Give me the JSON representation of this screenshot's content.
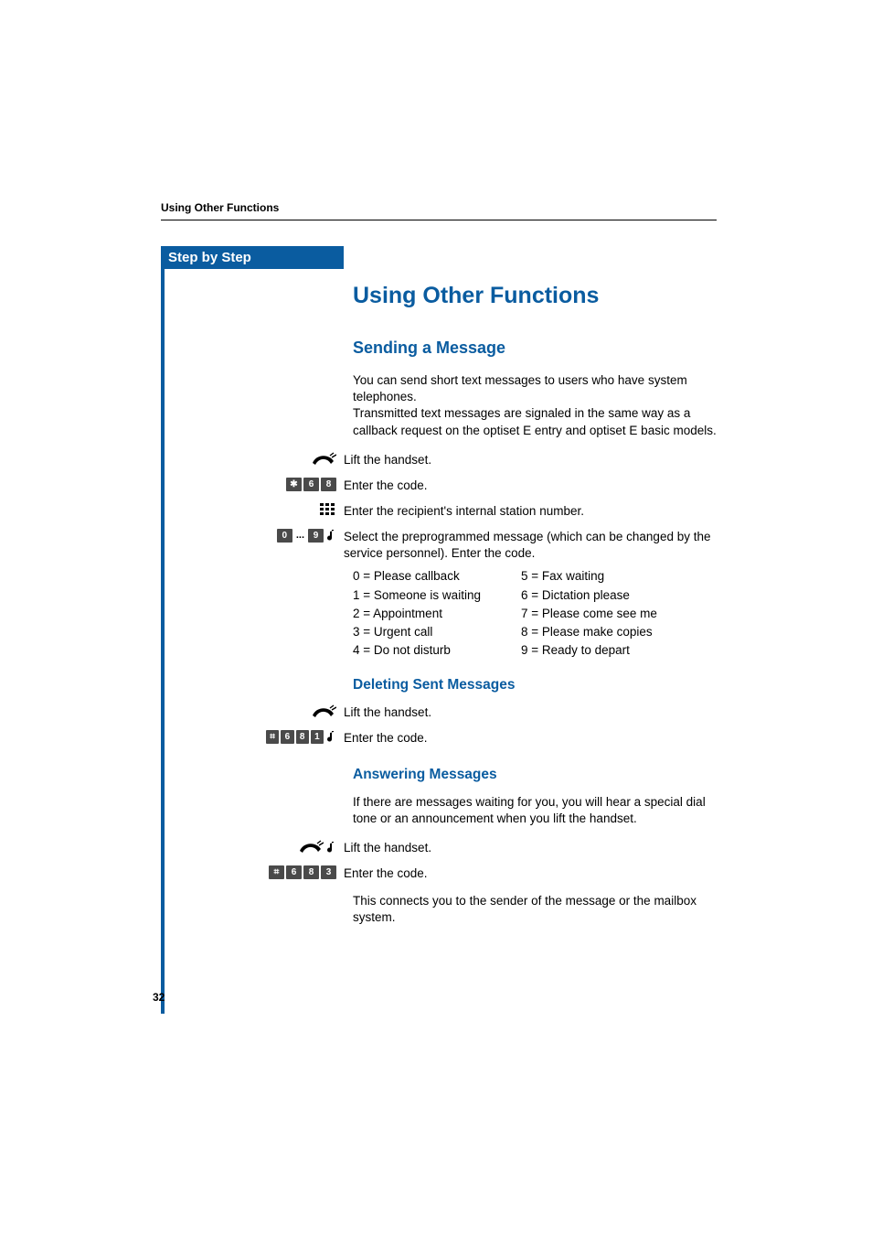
{
  "header": {
    "running": "Using Other Functions"
  },
  "sidebar": {
    "stepByStep": "Step by Step"
  },
  "title": "Using Other Functions",
  "section1": {
    "heading": "Sending a Message",
    "intro": "You can send short text messages to users who have system telephones.\nTransmitted text messages are signaled in the same way as a callback request on the optiset E entry and optiset E basic models.",
    "steps": {
      "lift": "Lift the handset.",
      "enterCode": "Enter the code.",
      "enterRecipient": "Enter the recipient's internal station number.",
      "selectMsg": "Select the preprogrammed message (which can be changed by the service personnel). Enter the code."
    },
    "keys": {
      "code": [
        "✱",
        "6",
        "8"
      ],
      "range": [
        "0",
        "9"
      ]
    },
    "options": {
      "left": [
        "0 = Please callback",
        "1 = Someone is waiting",
        "2 = Appointment",
        "3 = Urgent call",
        "4 = Do not disturb"
      ],
      "right": [
        "5 = Fax waiting",
        "6 = Dictation please",
        "7 = Please come see me",
        "8 = Please make copies",
        "9 = Ready to depart"
      ]
    }
  },
  "section2": {
    "heading": "Deleting Sent Messages",
    "steps": {
      "lift": "Lift the handset.",
      "enterCode": "Enter the code."
    },
    "keys": {
      "code": [
        "⌗",
        "6",
        "8",
        "1"
      ]
    }
  },
  "section3": {
    "heading": "Answering Messages",
    "intro": "If there are messages waiting for you, you will hear a special dial tone or an announcement when you lift the handset.",
    "steps": {
      "lift": "Lift the handset.",
      "enterCode": "Enter the code."
    },
    "keys": {
      "code": [
        "⌗",
        "6",
        "8",
        "3"
      ]
    },
    "outro": "This connects you to the sender of the message or the mailbox system."
  },
  "pageNumber": "32"
}
